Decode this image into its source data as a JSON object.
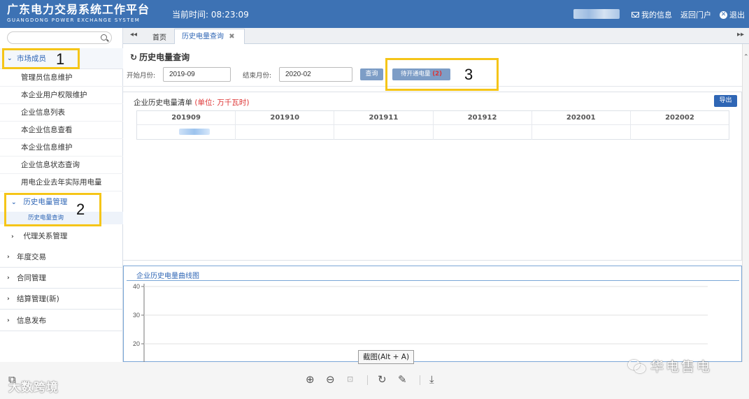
{
  "header": {
    "title_cn": "广东电力交易系统工作平台",
    "title_en": "GUANGDONG  POWER  EXCHANGE  SYSTEM",
    "clock_label": "当前时间:",
    "clock_value": "08:23:09",
    "links": {
      "messages": "我的信息",
      "portal": "返回门户",
      "logout": "退出"
    }
  },
  "sidebar": {
    "sections": [
      {
        "label": "市场成员",
        "open": true
      },
      {
        "label": "年度交易"
      },
      {
        "label": "合同管理"
      },
      {
        "label": "结算管理(新)"
      },
      {
        "label": "信息发布"
      }
    ],
    "member_items": [
      "管理员信息维护",
      "本企业用户权限维护",
      "企业信息列表",
      "本企业信息查看",
      "本企业信息维护",
      "企业信息状态查询",
      "用电企业去年实际用电量"
    ],
    "sub_history": "历史电量管理",
    "leaf_history_query": "历史电量查询",
    "sub_agency": "代理关系管理"
  },
  "tabs": {
    "home": "首页",
    "active": "历史电量查询"
  },
  "main": {
    "title": "历史电量查询",
    "start_label": "开始月份:",
    "start_value": "2019-09",
    "end_label": "结束月份:",
    "end_value": "2020-02",
    "query_btn": "查询",
    "pending_btn": "待开通电量",
    "pending_count": "(2)",
    "list_title": "企业历史电量清单",
    "list_unit": "(单位: 万千瓦时)",
    "export_btn": "导出",
    "columns": [
      "201909",
      "201910",
      "201911",
      "201912",
      "202001",
      "202002"
    ],
    "chart_title": "企业历史电量曲线图"
  },
  "chart_data": {
    "type": "line",
    "title": "企业历史电量曲线图",
    "xlabel": "",
    "ylabel": "",
    "ylim": [
      0,
      40
    ],
    "y_ticks": [
      "40",
      "30",
      "20"
    ],
    "grid": true,
    "series": []
  },
  "viewer": {
    "tooltip": "截图(Alt + A)"
  },
  "watermarks": {
    "left": "大数跨境",
    "right": "华电售电"
  },
  "annotations": [
    "1",
    "2",
    "3"
  ],
  "colors": {
    "header": "#3d72b4",
    "accent": "#2f66b5",
    "highlight": "#f5c518"
  }
}
